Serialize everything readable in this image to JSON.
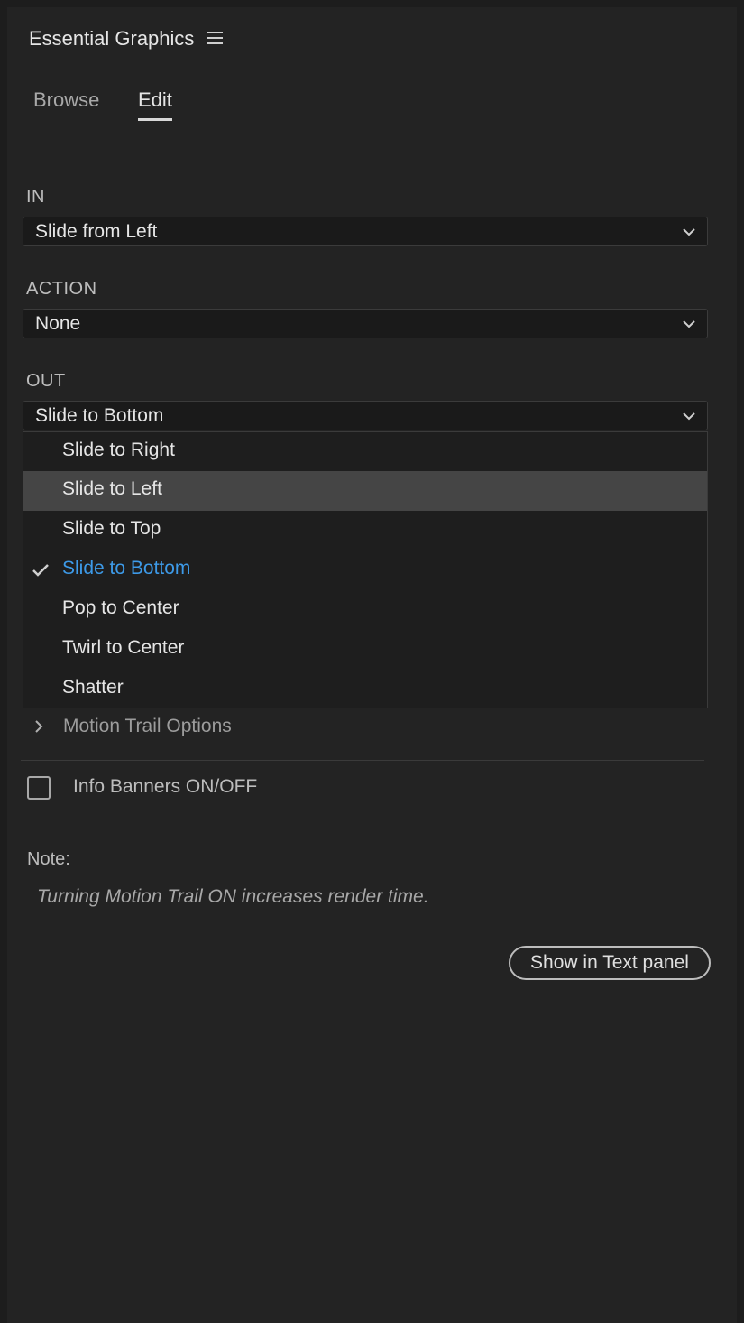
{
  "header": {
    "title": "Essential Graphics"
  },
  "tabs": {
    "browse": "Browse",
    "edit": "Edit",
    "active": "Edit"
  },
  "fields": {
    "in": {
      "label": "IN",
      "value": "Slide from Left"
    },
    "action": {
      "label": "ACTION",
      "value": "None"
    },
    "out": {
      "label": "OUT",
      "value": "Slide to Bottom"
    }
  },
  "out_menu": {
    "items": [
      {
        "label": "Slide to Right"
      },
      {
        "label": "Slide to Left"
      },
      {
        "label": "Slide to Top"
      },
      {
        "label": "Slide to Bottom"
      },
      {
        "label": "Pop to Center"
      },
      {
        "label": "Twirl to Center"
      },
      {
        "label": "Shatter"
      }
    ],
    "hovered": "Slide to Left",
    "selected": "Slide to Bottom"
  },
  "motion_trail": {
    "label": "Motion Trail Options"
  },
  "info_banners": {
    "label": "Info Banners ON/OFF",
    "checked": false
  },
  "note": {
    "label": "Note:",
    "text": "Turning Motion Trail ON increases render time."
  },
  "show_button": {
    "label": "Show in Text panel"
  },
  "colors": {
    "accent": "#3d9ae8",
    "panel_bg": "#232323",
    "hover_bg": "#454545"
  }
}
